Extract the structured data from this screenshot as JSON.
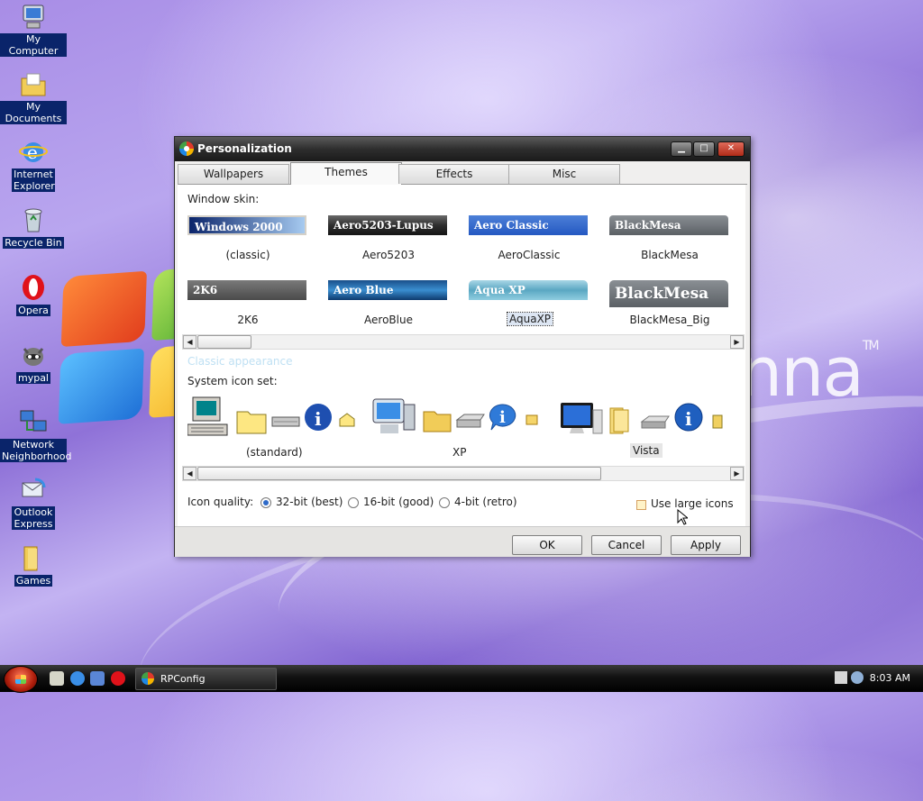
{
  "desktop": {
    "icons": [
      {
        "label": "My Computer",
        "icon": "my-computer-icon"
      },
      {
        "label": "My Documents",
        "icon": "my-documents-icon"
      },
      {
        "label": "Internet Explorer",
        "icon": "internet-explorer-icon"
      },
      {
        "label": "Recycle Bin",
        "icon": "recycle-bin-icon"
      },
      {
        "label": "Opera",
        "icon": "opera-icon"
      },
      {
        "label": "mypal",
        "icon": "mypal-icon"
      },
      {
        "label": "Network Neighborhood",
        "icon": "network-icon"
      },
      {
        "label": "Outlook Express",
        "icon": "outlook-express-icon"
      },
      {
        "label": "Games",
        "icon": "games-folder-icon"
      }
    ],
    "brand_text": "nna",
    "brand_tm": "TM"
  },
  "window": {
    "title": "Personalization",
    "controls": {
      "minimize": "▁",
      "maximize": "□",
      "close": "✕"
    },
    "tabs": [
      {
        "label": "Wallpapers",
        "active": false
      },
      {
        "label": "Themes",
        "active": true
      },
      {
        "label": "Effects",
        "active": false
      },
      {
        "label": "Misc",
        "active": false
      }
    ],
    "window_skin_label": "Window skin:",
    "skins": [
      {
        "bar_text": "Windows 2000",
        "name": "(classic)",
        "selected": false
      },
      {
        "bar_text": "Aero5203-Lupus",
        "name": "Aero5203",
        "selected": false
      },
      {
        "bar_text": "Aero Classic",
        "name": "AeroClassic",
        "selected": false
      },
      {
        "bar_text": "BlackMesa",
        "name": "BlackMesa",
        "selected": false
      },
      {
        "bar_text": "2K6",
        "name": "2K6",
        "selected": false
      },
      {
        "bar_text": "Aero Blue",
        "name": "AeroBlue",
        "selected": false
      },
      {
        "bar_text": "Aqua XP",
        "name": "AquaXP",
        "selected": true
      },
      {
        "bar_text": "BlackMesa",
        "name": "BlackMesa_Big",
        "selected": false
      }
    ],
    "classic_appearance_link": "Classic appearance",
    "system_icon_set_label": "System icon set:",
    "icon_sets": [
      {
        "name": "(standard)",
        "selected": false
      },
      {
        "name": "XP",
        "selected": false
      },
      {
        "name": "Vista",
        "selected": true
      }
    ],
    "icon_quality_label": "Icon quality:",
    "icon_quality_options": [
      {
        "label": "32-bit (best)",
        "selected": true
      },
      {
        "label": "16-bit (good)",
        "selected": false
      },
      {
        "label": "4-bit (retro)",
        "selected": false
      }
    ],
    "use_large_icons_label": "Use large icons",
    "use_large_icons_checked": false,
    "buttons": {
      "ok": "OK",
      "cancel": "Cancel",
      "apply": "Apply"
    }
  },
  "taskbar": {
    "task_button_label": "RPConfig",
    "clock": "8:03 AM"
  },
  "colors": {
    "titlebar": "#2e2e2e",
    "selection": "#dde6f3",
    "link_faded": "#bfe0f3"
  }
}
